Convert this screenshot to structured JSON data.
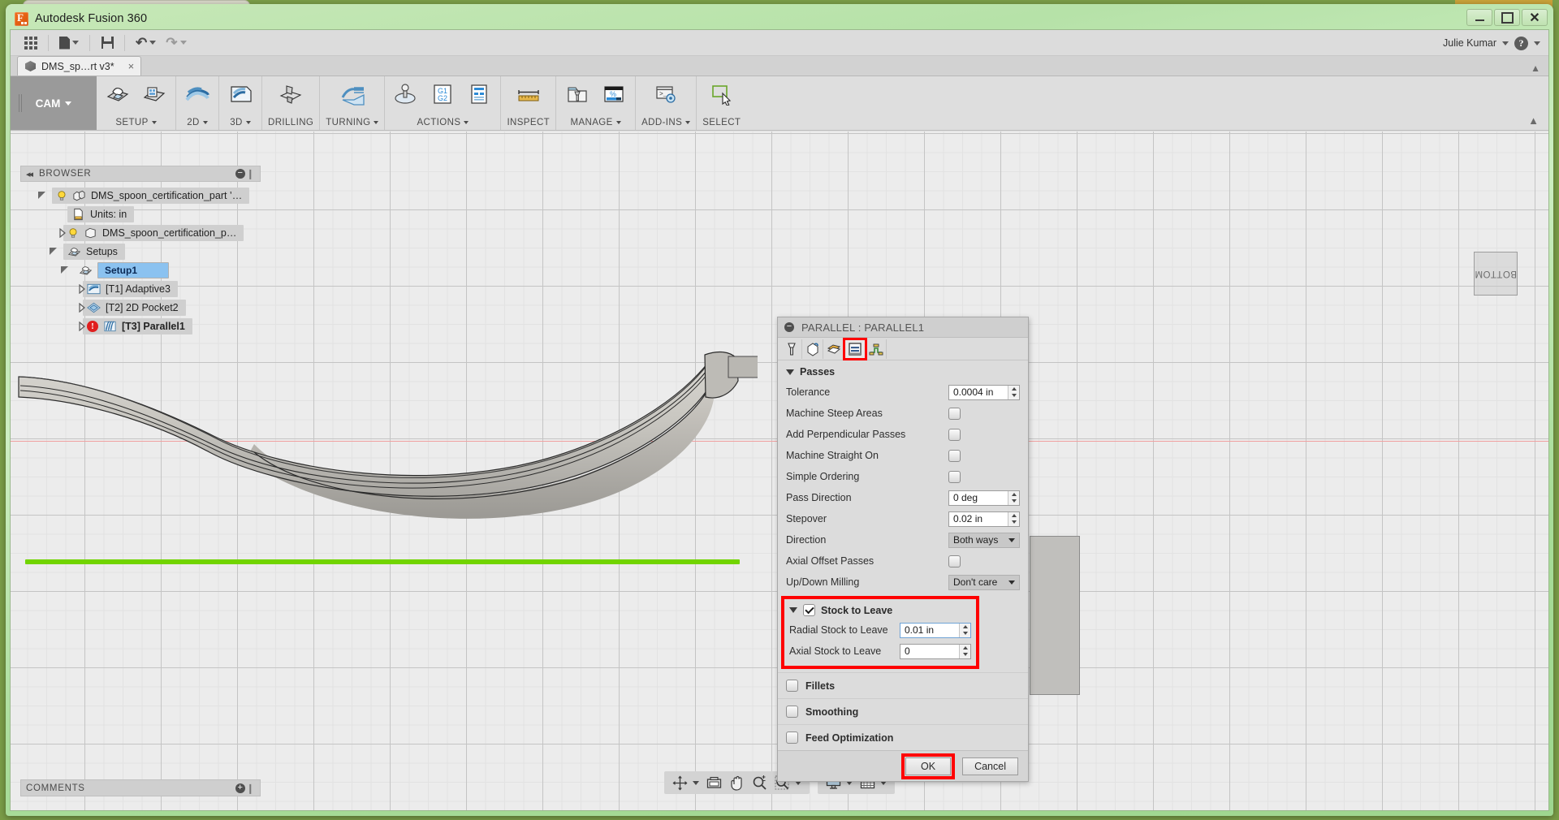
{
  "window": {
    "title": "Autodesk Fusion 360",
    "app_icon": "fusion-logo-icon",
    "minimize": "–",
    "maximize": "□",
    "close": "✕"
  },
  "quick_access": {
    "items": [
      {
        "name": "app-grid-icon",
        "label": "Show Data Panel"
      },
      {
        "name": "new-document-icon",
        "label": "File"
      },
      {
        "name": "save-icon",
        "label": "Save"
      },
      {
        "name": "undo-icon",
        "label": "Undo"
      },
      {
        "name": "redo-icon",
        "label": "Redo"
      }
    ],
    "user_name": "Julie Kumar",
    "help_icon": "help-question-icon"
  },
  "document_tab": {
    "label": "DMS_sp…rt v3*",
    "close": "×",
    "icon": "model-cube-icon"
  },
  "ribbon": {
    "workspace": "CAM",
    "groups": [
      {
        "label": "SETUP",
        "has_caret": true,
        "icons": [
          "setup-new-icon",
          "setup-folder-icon"
        ]
      },
      {
        "label": "2D",
        "has_caret": true,
        "icons": [
          "toolpath-2d-icon"
        ]
      },
      {
        "label": "3D",
        "has_caret": true,
        "icons": [
          "toolpath-3d-icon"
        ]
      },
      {
        "label": "DRILLING",
        "has_caret": false,
        "icons": [
          "drilling-icon"
        ]
      },
      {
        "label": "TURNING",
        "has_caret": true,
        "icons": [
          "turning-icon"
        ]
      },
      {
        "label": "ACTIONS",
        "has_caret": true,
        "icons": [
          "simulate-icon",
          "post-process-icon",
          "setup-sheet-icon"
        ]
      },
      {
        "label": "INSPECT",
        "has_caret": false,
        "icons": [
          "measure-icon"
        ]
      },
      {
        "label": "MANAGE",
        "has_caret": true,
        "icons": [
          "tool-library-icon",
          "machining-time-icon"
        ]
      },
      {
        "label": "ADD-INS",
        "has_caret": true,
        "icons": [
          "scripts-addins-icon"
        ]
      },
      {
        "label": "SELECT",
        "has_caret": false,
        "icons": [
          "select-cursor-icon"
        ]
      }
    ]
  },
  "browser": {
    "header": "BROWSER",
    "collapse_icon": "collapse-left-icon",
    "minus_icon": "−",
    "tree": [
      {
        "label": "DMS_spoon_certification_part ’…",
        "twist": "open",
        "bulb": true,
        "icon": "component-icon",
        "depth": 0,
        "selected": false,
        "error": false
      },
      {
        "label": "Units: in",
        "twist": "none",
        "bulb": false,
        "icon": "units-icon",
        "depth": 1,
        "selected": false,
        "error": false
      },
      {
        "label": "DMS_spoon_certification_p…",
        "twist": "closed",
        "bulb": true,
        "icon": "body-icon",
        "depth": 1,
        "selected": false,
        "error": false
      },
      {
        "label": "Setups",
        "twist": "open",
        "bulb": false,
        "icon": "setups-icon",
        "depth": 1,
        "selected": false,
        "error": false
      },
      {
        "label": "Setup1",
        "twist": "open",
        "bulb": false,
        "icon": "setup-icon",
        "depth": 2,
        "selected": true,
        "error": false
      },
      {
        "label": "[T1] Adaptive3",
        "twist": "closed",
        "bulb": false,
        "icon": "adaptive-icon",
        "depth": 3,
        "selected": false,
        "error": false
      },
      {
        "label": "[T2] 2D Pocket2",
        "twist": "closed",
        "bulb": false,
        "icon": "pocket-icon",
        "depth": 3,
        "selected": false,
        "error": false
      },
      {
        "label": "[T3] Parallel1",
        "twist": "closed",
        "bulb": false,
        "icon": "parallel-icon",
        "depth": 3,
        "selected": false,
        "error": true
      }
    ]
  },
  "comments": {
    "label": "COMMENTS",
    "plus_icon": "+"
  },
  "viewcube": {
    "face_label": "BOTTOM"
  },
  "navbar": {
    "groups": [
      {
        "buttons": [
          {
            "name": "orbit-icon",
            "caret": true
          },
          {
            "name": "display-views-icon",
            "caret": false
          },
          {
            "name": "pan-icon",
            "caret": false
          },
          {
            "name": "zoom-icon",
            "caret": false
          },
          {
            "name": "zoom-window-icon",
            "caret": true
          }
        ]
      },
      {
        "buttons": [
          {
            "name": "display-settings-icon",
            "caret": true
          },
          {
            "name": "grid-snaps-icon",
            "caret": true
          }
        ]
      }
    ]
  },
  "dialog": {
    "title": "PARALLEL : PARALLEL1",
    "minus_icon": "−",
    "tabs": [
      {
        "name": "tool-tab-icon",
        "active": false
      },
      {
        "name": "geometry-tab-icon",
        "active": false
      },
      {
        "name": "heights-tab-icon",
        "active": false
      },
      {
        "name": "passes-tab-icon",
        "active": true
      },
      {
        "name": "linking-tab-icon",
        "active": false
      }
    ],
    "section_passes": {
      "title": "Passes",
      "rows": [
        {
          "label": "Tolerance",
          "type": "spin",
          "value": "0.0004 in"
        },
        {
          "label": "Machine Steep Areas",
          "type": "checkbox",
          "checked": false
        },
        {
          "label": "Add Perpendicular Passes",
          "type": "checkbox",
          "checked": false
        },
        {
          "label": "Machine Straight On",
          "type": "checkbox",
          "checked": false
        },
        {
          "label": "Simple Ordering",
          "type": "checkbox",
          "checked": false
        },
        {
          "label": "Pass Direction",
          "type": "spin",
          "value": "0 deg"
        },
        {
          "label": "Stepover",
          "type": "spin",
          "value": "0.02 in"
        },
        {
          "label": "Direction",
          "type": "select",
          "value": "Both ways"
        },
        {
          "label": "Axial Offset Passes",
          "type": "checkbox",
          "checked": false
        },
        {
          "label": "Up/Down Milling",
          "type": "select",
          "value": "Don't care"
        }
      ]
    },
    "section_stock_to_leave": {
      "title": "Stock to Leave",
      "checked": true,
      "highlighted": true,
      "rows": [
        {
          "label": "Radial Stock to Leave",
          "value": "0.01 in"
        },
        {
          "label": "Axial Stock to Leave",
          "value": "0"
        }
      ]
    },
    "toggle_sections": [
      {
        "title": "Fillets",
        "checked": false
      },
      {
        "title": "Smoothing",
        "checked": false
      },
      {
        "title": "Feed Optimization",
        "checked": false
      }
    ],
    "footer": {
      "ok": "OK",
      "cancel": "Cancel",
      "ok_highlighted": true
    }
  },
  "colors": {
    "highlight_red": "#ff0000",
    "toolpath_green": "#72d400",
    "selection_blue": "#8bc2f0",
    "error_red": "#e01f1f",
    "window_frame_green": "#b6e2a8"
  }
}
